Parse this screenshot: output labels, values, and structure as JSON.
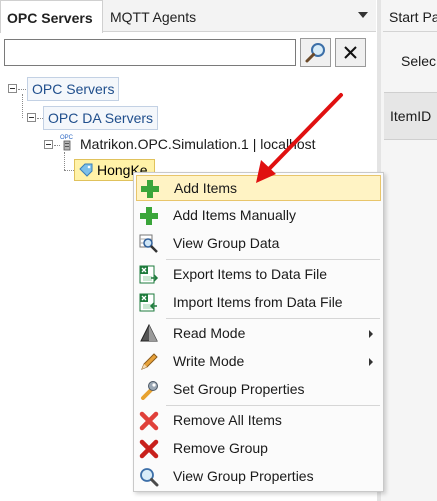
{
  "left_tabs": {
    "opc_servers": "OPC Servers",
    "mqtt_agents": "MQTT Agents"
  },
  "search": {
    "value": "",
    "placeholder": ""
  },
  "tree": {
    "root": "OPC Servers",
    "da_servers": "OPC DA Servers",
    "server": "Matrikon.OPC.Simulation.1 | localhost",
    "group": "HongKe",
    "opc_icon_text": "OPC"
  },
  "right_panel": {
    "tab": "Start Pa",
    "select_label": "Selec",
    "column_header": "ItemID"
  },
  "context_menu": {
    "items": [
      {
        "label": "Add Items",
        "icon": "green-plus-icon"
      },
      {
        "label": "Add Items Manually",
        "icon": "green-plus-icon"
      },
      {
        "label": "View Group Data",
        "icon": "magnifier-grid-icon"
      },
      {
        "label": "Export Items to Data File",
        "icon": "excel-export-icon"
      },
      {
        "label": "Import Items from Data File",
        "icon": "excel-import-icon"
      },
      {
        "label": "Read Mode",
        "icon": "read-mode-icon"
      },
      {
        "label": "Write Mode",
        "icon": "pencil-icon"
      },
      {
        "label": "Set Group Properties",
        "icon": "wrench-icon"
      },
      {
        "label": "Remove All Items",
        "icon": "red-x-icon"
      },
      {
        "label": "Remove Group",
        "icon": "red-x-icon"
      },
      {
        "label": "View Group Properties",
        "icon": "magnifier-icon"
      }
    ]
  },
  "colors": {
    "highlight": "#fff3c4",
    "selected_node": "#fff2a8",
    "arrow": "#e01010",
    "tree_link": "#1f4e8c"
  }
}
